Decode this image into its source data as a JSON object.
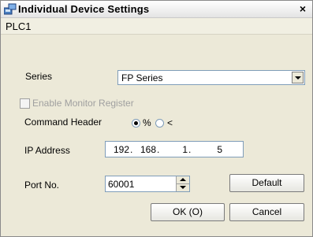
{
  "window": {
    "title": "Individual Device Settings",
    "close_label": "×"
  },
  "device": {
    "name": "PLC1"
  },
  "series": {
    "label": "Series",
    "selected": "FP Series"
  },
  "monitor": {
    "label": "Enable Monitor Register",
    "checked": false,
    "enabled": false
  },
  "command_header": {
    "label": "Command Header",
    "options": [
      {
        "label": "%",
        "checked": true
      },
      {
        "label": "<",
        "checked": false
      }
    ]
  },
  "ip": {
    "label": "IP Address",
    "octets": [
      "192",
      "168",
      "1",
      "5"
    ]
  },
  "port": {
    "label": "Port No.",
    "value": "60001"
  },
  "buttons": {
    "default": "Default",
    "ok": "OK (O)",
    "cancel": "Cancel"
  },
  "icons": {
    "title_icon": "device-settings-icon",
    "close": "close-icon"
  }
}
